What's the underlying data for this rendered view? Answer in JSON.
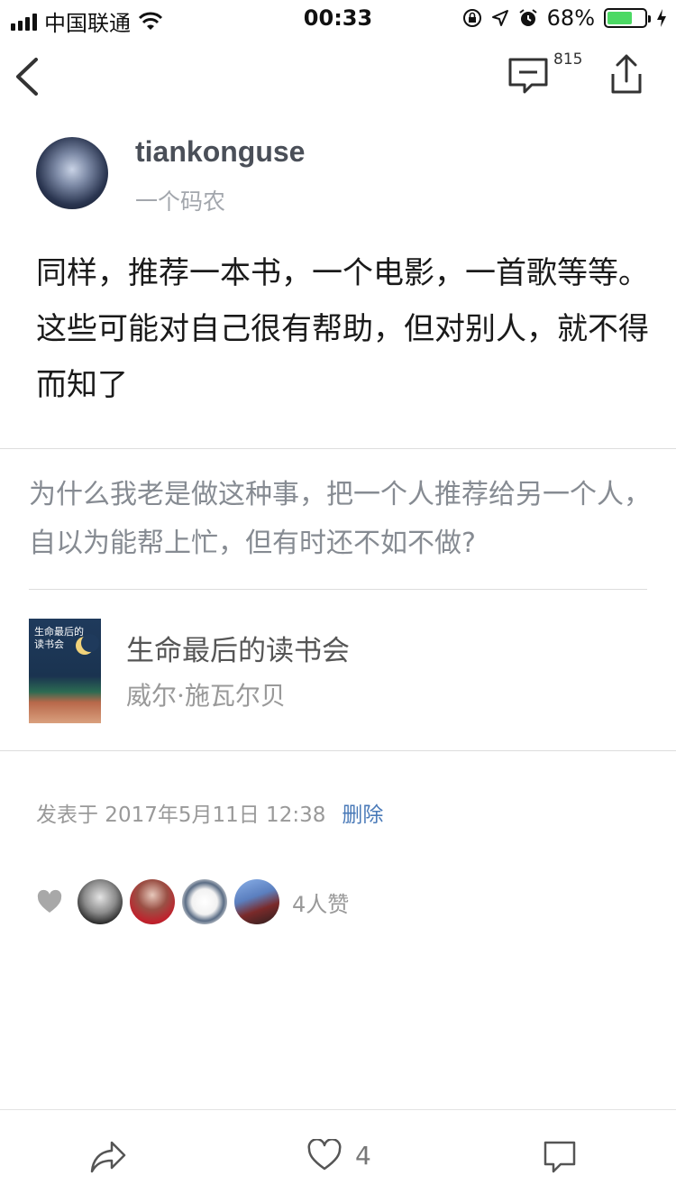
{
  "status_bar": {
    "carrier": "中国联通",
    "time": "00:33",
    "battery_percent": "68%",
    "battery_level": 0.68
  },
  "nav": {
    "comment_count": "815"
  },
  "author": {
    "name": "tiankonguse",
    "bio": "一个码农"
  },
  "post": {
    "content": "同样，推荐一本书，一个电影，一首歌等等。这些可能对自己很有帮助，但对别人，就不得而知了",
    "question": "为什么我老是做这种事，把一个人推荐给另一个人，自以为能帮上忙，但有时还不如不做?",
    "book": {
      "cover_text_line1": "生命最后的",
      "cover_text_line2": "读书会",
      "title": "生命最后的读书会",
      "author": "威尔·施瓦尔贝"
    },
    "published": "发表于 2017年5月11日 12:38",
    "delete_label": "删除"
  },
  "likes": {
    "count_text": "4人赞"
  },
  "bottom_bar": {
    "like_count": "4"
  },
  "colors": {
    "link": "#4a7ab8",
    "battery": "#4cd964"
  }
}
